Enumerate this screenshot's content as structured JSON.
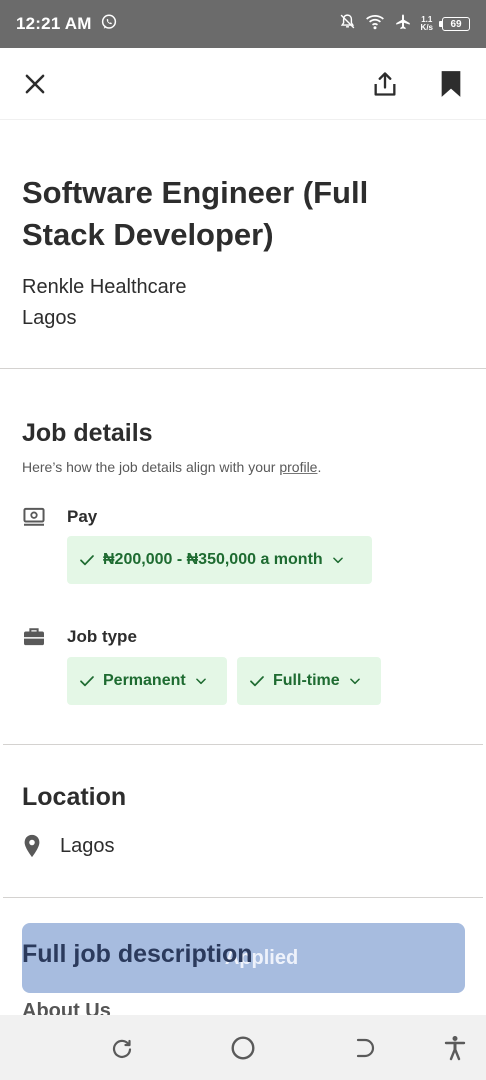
{
  "status_bar": {
    "time": "12:21 AM",
    "net_speed_value": "1.1",
    "net_speed_unit": "K/s",
    "battery_level": "69",
    "icons": [
      "whatsapp-icon",
      "notifications-off-icon",
      "wifi-icon",
      "airplane-icon",
      "battery-icon"
    ]
  },
  "header": {
    "icons": [
      "close-icon",
      "share-icon",
      "bookmark-icon"
    ]
  },
  "job": {
    "title": "Software Engineer (Full Stack Developer)",
    "company": "Renkle Healthcare",
    "location": "Lagos"
  },
  "job_details": {
    "heading": "Job details",
    "subtext_prefix": "Here’s how the job details align with your ",
    "subtext_link": "profile",
    "subtext_suffix": ".",
    "pay": {
      "label": "Pay",
      "chip": "₦200,000 - ₦350,000 a month"
    },
    "job_type": {
      "label": "Job type",
      "chips": [
        "Permanent",
        "Full-time"
      ]
    }
  },
  "location_section": {
    "heading": "Location",
    "value": "Lagos"
  },
  "description": {
    "heading": "Full job description",
    "about_heading": "About Us"
  },
  "apply_button": {
    "label": "Applied"
  },
  "colors": {
    "chip_bg": "#e4f7e6",
    "chip_text": "#1e6b31",
    "apply_bg": "#a7bcdf",
    "status_bar": "#6b6b6b"
  }
}
